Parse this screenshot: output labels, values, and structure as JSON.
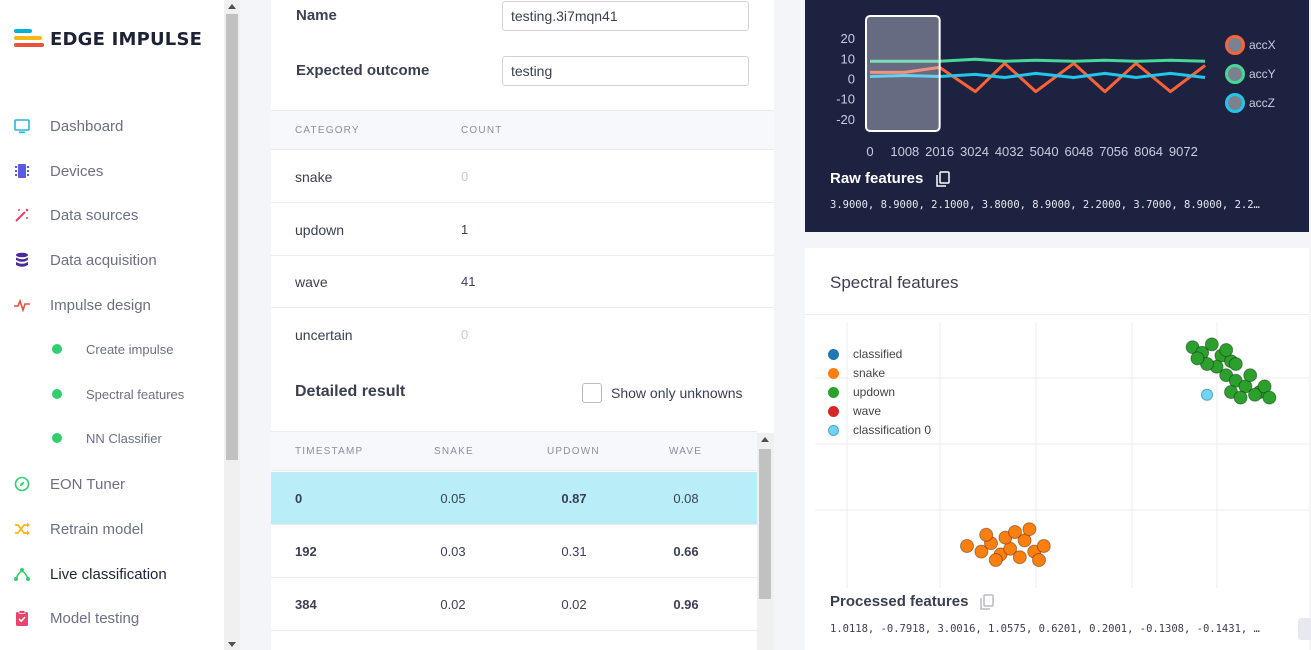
{
  "app": {
    "logo_text": "EDGE IMPULSE"
  },
  "sidebar": {
    "items": [
      {
        "label": "Dashboard",
        "icon": "monitor-icon",
        "color": "#22b8d8"
      },
      {
        "label": "Devices",
        "icon": "chip-icon",
        "color": "#5b5be0"
      },
      {
        "label": "Data sources",
        "icon": "magic-wand-icon",
        "color": "#e8436c"
      },
      {
        "label": "Data acquisition",
        "icon": "database-icon",
        "color": "#4b2a9a"
      },
      {
        "label": "Impulse design",
        "icon": "pulse-icon",
        "color": "#e8513b"
      },
      {
        "label": "Create impulse",
        "icon": "status-dot-icon",
        "color": "#2ecf6e"
      },
      {
        "label": "Spectral features",
        "icon": "status-dot-icon",
        "color": "#2ecf6e"
      },
      {
        "label": "NN Classifier",
        "icon": "status-dot-icon",
        "color": "#2ecf6e"
      },
      {
        "label": "EON Tuner",
        "icon": "compass-icon",
        "color": "#2ecf6e"
      },
      {
        "label": "Retrain model",
        "icon": "shuffle-icon",
        "color": "#f6b817"
      },
      {
        "label": "Live classification",
        "icon": "nodes-icon",
        "color": "#2ecf6e"
      },
      {
        "label": "Model testing",
        "icon": "clipboard-check-icon",
        "color": "#e8436c"
      }
    ],
    "active": "Live classification"
  },
  "summary": {
    "name_label": "Name",
    "name_value": "testing.3i7mqn41",
    "outcome_label": "Expected outcome",
    "outcome_value": "testing"
  },
  "category_table": {
    "headers": [
      "CATEGORY",
      "COUNT"
    ],
    "rows": [
      {
        "category": "snake",
        "count": "0"
      },
      {
        "category": "updown",
        "count": "1"
      },
      {
        "category": "wave",
        "count": "41"
      },
      {
        "category": "uncertain",
        "count": "0"
      }
    ]
  },
  "detailed": {
    "title": "Detailed result",
    "show_unknowns_label": "Show only unknowns",
    "show_unknowns_checked": false,
    "headers": [
      "TIMESTAMP",
      "SNAKE",
      "UPDOWN",
      "WAVE"
    ],
    "rows": [
      {
        "timestamp": "0",
        "snake": "0.05",
        "updown": "0.87",
        "wave": "0.08",
        "selected": true
      },
      {
        "timestamp": "192",
        "snake": "0.03",
        "updown": "0.31",
        "wave": "0.66",
        "selected": false
      },
      {
        "timestamp": "384",
        "snake": "0.02",
        "updown": "0.02",
        "wave": "0.96",
        "selected": false
      }
    ]
  },
  "raw": {
    "title": "Raw features",
    "values": "3.9000, 8.9000, 2.1000, 3.8000, 8.9000, 2.2000, 3.7000, 8.9000, 2.2…",
    "y_ticks": [
      "20",
      "10",
      "0",
      "-10",
      "-20"
    ],
    "x_ticks": [
      "0",
      "1008",
      "2016",
      "3024",
      "4032",
      "5040",
      "6048",
      "7056",
      "8064",
      "9072"
    ],
    "legend": [
      {
        "name": "accX",
        "color": "#ff6237"
      },
      {
        "name": "accY",
        "color": "#45d898"
      },
      {
        "name": "accZ",
        "color": "#22c6ea"
      }
    ]
  },
  "spectral": {
    "title": "Spectral features",
    "legend": [
      {
        "name": "classified",
        "color": "#1f77b4"
      },
      {
        "name": "snake",
        "color": "#ff7f0e"
      },
      {
        "name": "updown",
        "color": "#2ca02c"
      },
      {
        "name": "wave",
        "color": "#d62728"
      },
      {
        "name": "classification 0",
        "color": "#72d4f2"
      }
    ],
    "processed_title": "Processed features",
    "processed_values": "1.0118, -0.7918, 3.0016, 1.0575, 0.6201, 0.2001, -0.1308, -0.1431, …"
  },
  "chart_data": [
    {
      "type": "line",
      "title": "",
      "xlabel": "",
      "ylabel": "",
      "ylim": [
        -25,
        25
      ],
      "xlim": [
        0,
        9900
      ],
      "highlight_window": [
        0,
        2016
      ],
      "series": [
        {
          "name": "accX",
          "x": [
            0,
            1000,
            2016,
            3050,
            3900,
            4800,
            5900,
            6800,
            7700,
            8700,
            9700
          ],
          "values": [
            3.5,
            3.5,
            6,
            -6,
            8,
            -6,
            8,
            -6,
            8,
            -6,
            7
          ]
        },
        {
          "name": "accY",
          "x": [
            0,
            1000,
            2016,
            3050,
            3900,
            4800,
            5900,
            6800,
            7700,
            8700,
            9700
          ],
          "values": [
            9,
            9,
            9,
            10,
            9,
            9.5,
            9,
            9.5,
            9,
            9.5,
            9
          ]
        },
        {
          "name": "accZ",
          "x": [
            0,
            1000,
            2016,
            3050,
            3900,
            4800,
            5900,
            6800,
            7700,
            8700,
            9700
          ],
          "values": [
            1.5,
            2,
            1.5,
            2.5,
            1,
            3,
            1,
            3,
            1,
            3,
            1
          ]
        }
      ]
    },
    {
      "type": "scatter",
      "title": "",
      "series": [
        {
          "name": "snake",
          "points": [
            [
              2.5,
              1.5
            ],
            [
              2.8,
              1.3
            ],
            [
              3.0,
              1.6
            ],
            [
              3.2,
              1.2
            ],
            [
              3.4,
              1.4
            ],
            [
              3.6,
              1.1
            ],
            [
              3.7,
              1.7
            ],
            [
              3.9,
              1.3
            ],
            [
              4.1,
              1.5
            ],
            [
              2.9,
              1.9
            ],
            [
              3.3,
              1.8
            ],
            [
              3.5,
              2.0
            ],
            [
              3.8,
              2.1
            ],
            [
              4.0,
              1.0
            ],
            [
              3.1,
              1.0
            ]
          ]
        },
        {
          "name": "updown",
          "points": [
            [
              7.2,
              8.6
            ],
            [
              7.4,
              8.4
            ],
            [
              7.6,
              8.7
            ],
            [
              7.8,
              8.3
            ],
            [
              8.0,
              8.1
            ],
            [
              7.7,
              7.9
            ],
            [
              7.9,
              7.6
            ],
            [
              8.1,
              7.4
            ],
            [
              8.3,
              7.2
            ],
            [
              8.0,
              7.0
            ],
            [
              8.4,
              7.6
            ],
            [
              8.6,
              7.0
            ],
            [
              8.2,
              6.8
            ],
            [
              8.5,
              6.9
            ],
            [
              7.5,
              8.0
            ],
            [
              7.3,
              8.2
            ],
            [
              8.7,
              7.2
            ],
            [
              8.8,
              6.8
            ],
            [
              7.9,
              8.5
            ],
            [
              8.1,
              8.0
            ]
          ]
        },
        {
          "name": "classification 0",
          "points": [
            [
              7.5,
              6.9
            ]
          ]
        }
      ]
    }
  ]
}
